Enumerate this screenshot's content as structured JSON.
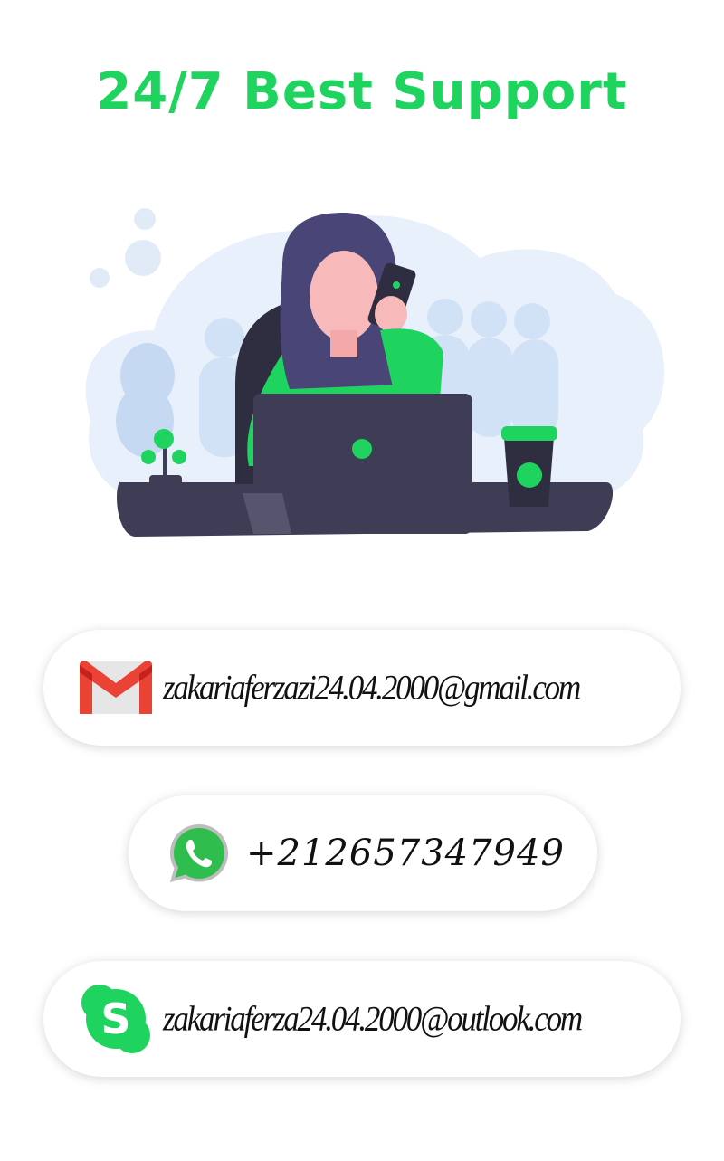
{
  "page": {
    "title": "24/7 Best Support",
    "accent_color": "#1ed45f"
  },
  "illustration": {
    "icon": "support-agent-illustration-icon"
  },
  "contacts": [
    {
      "type": "email",
      "icon": "gmail-icon",
      "value": "zakariaferzazi24.04.2000@gmail.com"
    },
    {
      "type": "whatsapp",
      "icon": "whatsapp-icon",
      "value": "+212657347949"
    },
    {
      "type": "skype",
      "icon": "skype-icon",
      "value": "zakariaferza24.04.2000@outlook.com"
    }
  ]
}
